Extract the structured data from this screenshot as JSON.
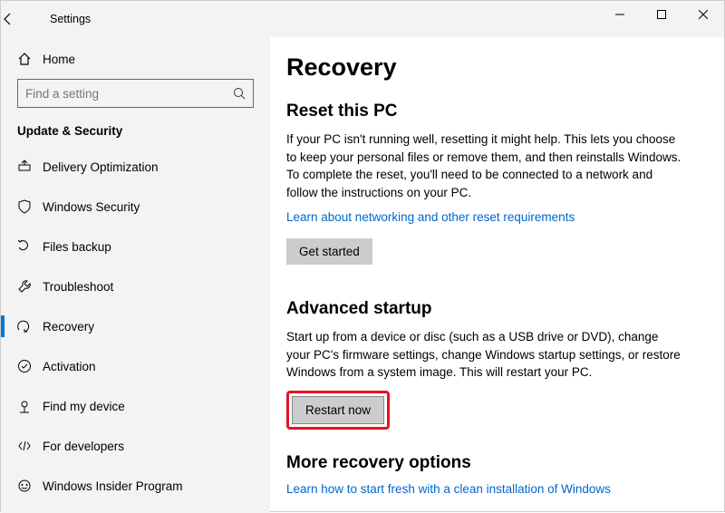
{
  "window": {
    "title": "Settings"
  },
  "sidebar": {
    "home_label": "Home",
    "search_placeholder": "Find a setting",
    "group_header": "Update & Security",
    "items": [
      {
        "label": "Delivery Optimization"
      },
      {
        "label": "Windows Security"
      },
      {
        "label": "Files backup"
      },
      {
        "label": "Troubleshoot"
      },
      {
        "label": "Recovery"
      },
      {
        "label": "Activation"
      },
      {
        "label": "Find my device"
      },
      {
        "label": "For developers"
      },
      {
        "label": "Windows Insider Program"
      }
    ]
  },
  "main": {
    "page_title": "Recovery",
    "reset": {
      "heading": "Reset this PC",
      "body": "If your PC isn't running well, resetting it might help. This lets you choose to keep your personal files or remove them, and then reinstalls Windows. To complete the reset, you'll need to be connected to a network and follow the instructions on your PC.",
      "link": "Learn about networking and other reset requirements",
      "button": "Get started"
    },
    "advanced": {
      "heading": "Advanced startup",
      "body": "Start up from a device or disc (such as a USB drive or DVD), change your PC's firmware settings, change Windows startup settings, or restore Windows from a system image. This will restart your PC.",
      "button": "Restart now"
    },
    "more": {
      "heading": "More recovery options",
      "link": "Learn how to start fresh with a clean installation of Windows"
    }
  }
}
